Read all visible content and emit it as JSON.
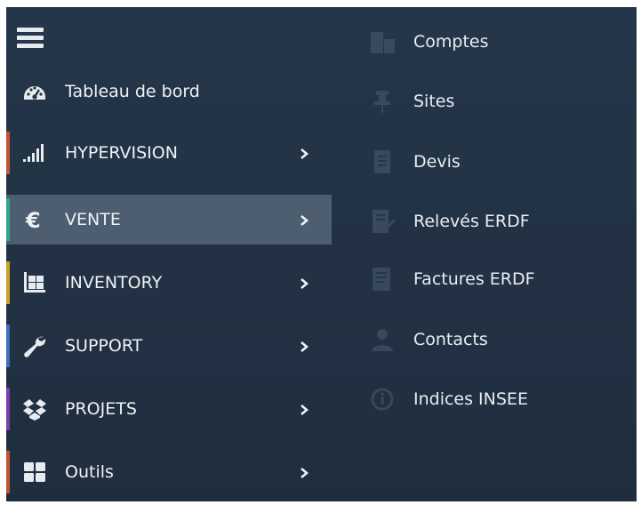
{
  "menu": {
    "items": [
      {
        "label": "Tableau de bord",
        "icon": "tachometer-icon",
        "accent": ""
      },
      {
        "label": "HYPERVISION",
        "icon": "signal-bars-icon",
        "accent": "#c0533a"
      },
      {
        "label": "VENTE",
        "icon": "euro-icon",
        "accent": "#2fa98c"
      },
      {
        "label": "INVENTORY",
        "icon": "pallet-boxes-icon",
        "accent": "#c9a227"
      },
      {
        "label": "SUPPORT",
        "icon": "wrench-icon",
        "accent": "#3f6fb5"
      },
      {
        "label": "PROJETS",
        "icon": "dropbox-icon",
        "accent": "#7a3fa8"
      },
      {
        "label": "Outils",
        "icon": "grid-icon",
        "accent": "#c0533a"
      }
    ],
    "active": "VENTE"
  },
  "submenu": {
    "items": [
      {
        "label": "Comptes",
        "icon": "buildings-icon"
      },
      {
        "label": "Sites",
        "icon": "pin-icon"
      },
      {
        "label": "Devis",
        "icon": "document-icon"
      },
      {
        "label": "Relevés ERDF",
        "icon": "readings-icon"
      },
      {
        "label": "Factures ERDF",
        "icon": "invoice-icon"
      },
      {
        "label": "Contacts",
        "icon": "user-icon"
      },
      {
        "label": "Indices INSEE",
        "icon": "circle-info-icon"
      }
    ]
  },
  "colors": {
    "background": "#243446",
    "active_background": "#4c5e6f",
    "text": "#eef2f5"
  }
}
